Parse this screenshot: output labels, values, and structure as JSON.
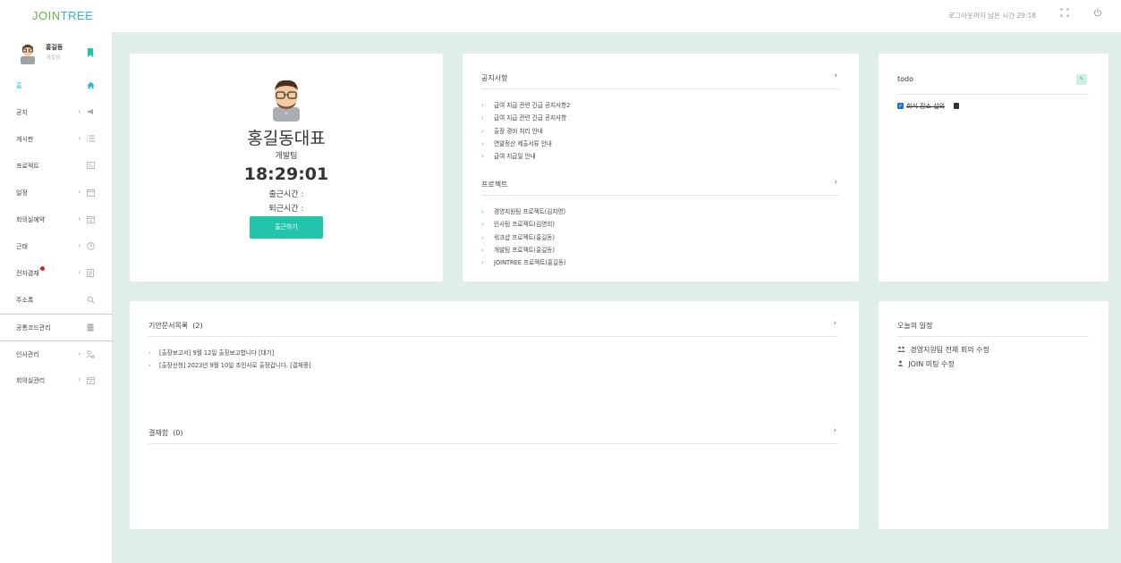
{
  "header": {
    "logo_part1": "JOIN",
    "logo_part2": "TREE",
    "logout_timer": "로그아웃까지 남은 시간 29:18",
    "fullscreen_icon": "fullscreen-icon",
    "power_icon": "power-icon"
  },
  "sidebar": {
    "user": {
      "name": "홍길동",
      "role": "개발팀"
    },
    "items": [
      {
        "label": "홈",
        "icon": "home-icon",
        "active": true,
        "has_chevron": false
      },
      {
        "label": "공지",
        "icon": "megaphone-icon",
        "has_chevron": true
      },
      {
        "label": "게시판",
        "icon": "list-icon",
        "has_chevron": true
      },
      {
        "label": "프로젝트",
        "icon": "board-icon",
        "has_chevron": false
      },
      {
        "label": "일정",
        "icon": "calendar-icon",
        "has_chevron": true
      },
      {
        "label": "회의실예약",
        "icon": "calendar-check-icon",
        "has_chevron": true
      },
      {
        "label": "근태",
        "icon": "clock-icon",
        "has_chevron": true
      },
      {
        "label": "전자결재",
        "icon": "document-icon",
        "has_chevron": true,
        "notification": true
      },
      {
        "label": "주소록",
        "icon": "search-user-icon",
        "has_chevron": false
      },
      {
        "label": "공통코드관리",
        "icon": "database-icon",
        "has_chevron": false
      },
      {
        "label": "인사관리",
        "icon": "user-settings-icon",
        "has_chevron": true
      },
      {
        "label": "회의실관리",
        "icon": "calendar-edit-icon",
        "has_chevron": true
      }
    ]
  },
  "profile_card": {
    "name": "홍길동대표",
    "team": "개발팀",
    "clock": "18:29:01",
    "check_in_label": "출근시간 :",
    "check_out_label": "퇴근시간 :",
    "check_in_button": "출근하기"
  },
  "notice_card": {
    "notice_title": "공지사항",
    "notices": [
      "급여 지급 관련 긴급 공지사항2",
      "급여 지급 관련 긴급 공지사항",
      "출장 경비 처리 안내",
      "연말정산 제출서류 안내",
      "급여 지급일 안내"
    ],
    "project_title": "프로젝트",
    "projects": [
      "경영지원팀 프로젝트(김지영)",
      "인사팀 프로젝트(김영희)",
      "워크샵 프로젝트(홍길동)",
      "개발팀 프로젝트(홍길동)",
      "JOINTREE 프로젝트(홍길동)"
    ]
  },
  "todo_card": {
    "title": "todo",
    "add_icon": "add-todo-icon",
    "items": [
      {
        "text": "회식 장소 섭외",
        "done": true
      }
    ]
  },
  "docs_card": {
    "draft_title": "기안문서목록",
    "draft_count": "(2)",
    "drafts": [
      "[출장보고서] 9월 12일 출장보고합니다   [대기]",
      "[출장신청] 2023년 9월 10일 조인사로 출장갑니다.   [결재중]"
    ],
    "approval_title": "결재함",
    "approval_count": "(0)"
  },
  "schedule_card": {
    "title": "오늘의 일정",
    "items": [
      {
        "icon": "group-icon",
        "text": "경영지원팀 전체 회의 수정"
      },
      {
        "icon": "person-icon",
        "text": "JOIN 미팅 수정"
      }
    ]
  },
  "colors": {
    "accent": "#22c5a9",
    "logo_green": "#6ab04c",
    "logo_blue": "#2bb8d0",
    "background": "#e0eee8"
  }
}
